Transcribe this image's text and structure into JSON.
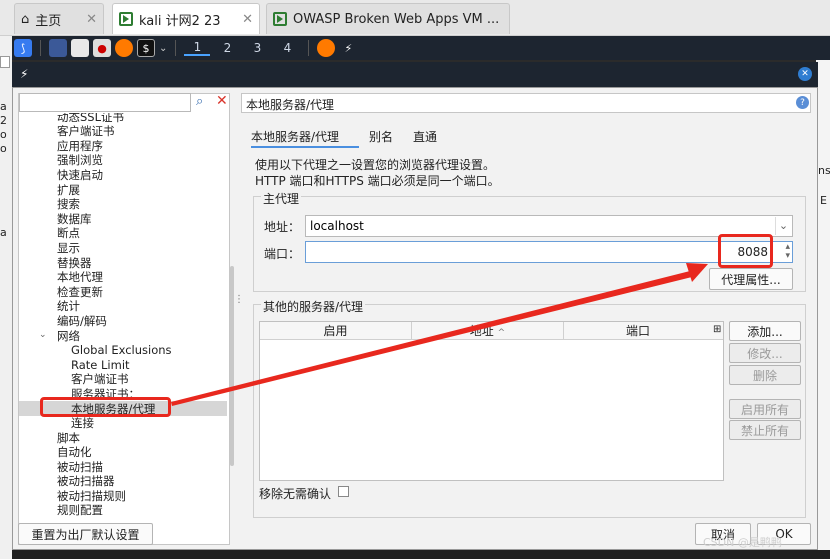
{
  "browser_tabs": [
    {
      "label": "主页"
    },
    {
      "label": "kali 计网2 23"
    },
    {
      "label": "OWASP Broken Web Apps VM ..."
    }
  ],
  "panel": {
    "workspaces": [
      "1",
      "2",
      "3",
      "4"
    ]
  },
  "left_slice": [
    "a",
    "2",
    "o",
    "o",
    "a"
  ],
  "right_slice": [
    "ns",
    "E"
  ],
  "sidebar": {
    "search_value": "",
    "items": [
      "动态SSL证书",
      "客户端证书",
      "应用程序",
      "强制浏览",
      "快速启动",
      "扩展",
      "搜索",
      "数据库",
      "断点",
      "显示",
      "替换器",
      "本地代理",
      "检查更新",
      "统计",
      "编码/解码",
      "网络",
      "Global Exclusions",
      "Rate Limit",
      "客户端证书",
      "服务器证书：",
      "本地服务器/代理",
      "连接",
      "脚本",
      "自动化",
      "被动扫描",
      "被动扫描器",
      "被动扫描规则",
      "规则配置"
    ],
    "reset_label": "重置为出厂默认设置"
  },
  "header": {
    "title": "本地服务器/代理"
  },
  "tabs": [
    "本地服务器/代理",
    "别名",
    "直通"
  ],
  "desc": [
    "使用以下代理之一设置您的浏览器代理设置。",
    "HTTP 端口和HTTPS 端口必须是同一个端口。"
  ],
  "main_proxy": {
    "legend": "主代理",
    "address_label": "地址：",
    "address_value": "localhost",
    "port_label": "端口：",
    "port_value": "8088",
    "props_button": "代理属性..."
  },
  "other": {
    "legend": "其他的服务器/代理",
    "columns": [
      "启用",
      "地址",
      "端口"
    ],
    "buttons": [
      "添加...",
      "修改...",
      "删除",
      "启用所有",
      "禁止所有"
    ],
    "remove_confirm": "移除无需确认"
  },
  "footer": {
    "cancel": "取消",
    "ok": "OK"
  },
  "watermark": "CSDN @是鸭鸭",
  "colors": {
    "annotation": "#e8281e",
    "panel": "#1d2530",
    "accent": "#4aa3ff"
  }
}
